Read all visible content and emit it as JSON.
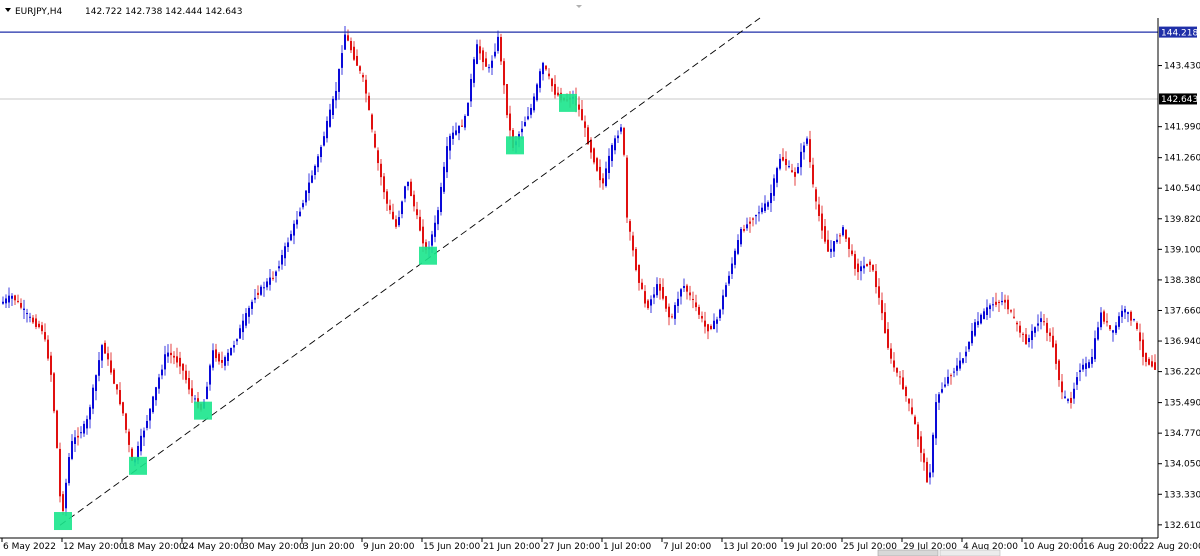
{
  "header": {
    "symbol": "EURJPY,H4",
    "ohlc": "142.722 142.738 142.444 142.643"
  },
  "colors": {
    "bull": "#0a0ad8",
    "bear": "#e01010",
    "resistance": "#1f2fa8",
    "current_price_line": "#c8c8c8",
    "trendline": "#000000",
    "marker": "#19e68c",
    "axis": "#000000"
  },
  "price_tags": {
    "resistance": "144.218",
    "current": "142.643"
  },
  "chart_data": {
    "type": "candlestick",
    "title": "",
    "xlabel": "",
    "ylabel": "",
    "ylim": [
      132.3,
      144.55
    ],
    "grid": false,
    "y_ticks": [
      "143.430",
      "142.643",
      "141.990",
      "141.260",
      "140.540",
      "139.820",
      "139.100",
      "138.380",
      "137.660",
      "136.940",
      "136.220",
      "135.490",
      "134.770",
      "134.050",
      "133.330",
      "132.610"
    ],
    "x_ticks": [
      "6 May 2022",
      "12 May 20:00",
      "18 May 20:00",
      "24 May 20:00",
      "30 May 20:00",
      "3 Jun 20:00",
      "9 Jun 20:00",
      "15 Jun 20:00",
      "21 Jun 20:00",
      "27 Jun 20:00",
      "1 Jul 20:00",
      "7 Jul 20:00",
      "13 Jul 20:00",
      "19 Jul 20:00",
      "25 Jul 20:00",
      "29 Jul 20:00",
      "4 Aug 20:00",
      "10 Aug 20:00",
      "16 Aug 20:00",
      "22 Aug 20:00"
    ],
    "resistance_level": 144.218,
    "current_price": 142.643,
    "price_path": [
      [
        0,
        137.8
      ],
      [
        14,
        138.0
      ],
      [
        30,
        137.5
      ],
      [
        44,
        137.2
      ],
      [
        52,
        136.3
      ],
      [
        58,
        134.6
      ],
      [
        63,
        132.7
      ],
      [
        72,
        134.5
      ],
      [
        88,
        135.0
      ],
      [
        104,
        136.9
      ],
      [
        114,
        136.1
      ],
      [
        124,
        135.3
      ],
      [
        134,
        134.0
      ],
      [
        150,
        135.2
      ],
      [
        168,
        136.7
      ],
      [
        182,
        136.4
      ],
      [
        194,
        135.6
      ],
      [
        204,
        135.3
      ],
      [
        214,
        136.7
      ],
      [
        224,
        136.4
      ],
      [
        236,
        136.9
      ],
      [
        256,
        138.0
      ],
      [
        276,
        138.5
      ],
      [
        298,
        139.8
      ],
      [
        320,
        141.3
      ],
      [
        338,
        142.9
      ],
      [
        346,
        144.2
      ],
      [
        356,
        143.6
      ],
      [
        366,
        143.0
      ],
      [
        376,
        141.5
      ],
      [
        388,
        140.2
      ],
      [
        398,
        139.6
      ],
      [
        408,
        140.8
      ],
      [
        420,
        139.7
      ],
      [
        428,
        139.0
      ],
      [
        438,
        139.8
      ],
      [
        450,
        141.7
      ],
      [
        466,
        142.1
      ],
      [
        478,
        143.9
      ],
      [
        490,
        143.3
      ],
      [
        500,
        144.1
      ],
      [
        508,
        142.4
      ],
      [
        514,
        141.5
      ],
      [
        524,
        142.0
      ],
      [
        534,
        142.5
      ],
      [
        544,
        143.5
      ],
      [
        556,
        142.8
      ],
      [
        566,
        142.6
      ],
      [
        574,
        142.7
      ],
      [
        582,
        142.3
      ],
      [
        590,
        141.6
      ],
      [
        604,
        140.6
      ],
      [
        612,
        141.4
      ],
      [
        624,
        142.1
      ],
      [
        628,
        139.9
      ],
      [
        638,
        138.6
      ],
      [
        648,
        137.7
      ],
      [
        660,
        138.3
      ],
      [
        672,
        137.4
      ],
      [
        684,
        138.3
      ],
      [
        696,
        137.8
      ],
      [
        708,
        137.2
      ],
      [
        718,
        137.4
      ],
      [
        728,
        138.3
      ],
      [
        742,
        139.5
      ],
      [
        756,
        139.9
      ],
      [
        770,
        140.2
      ],
      [
        782,
        141.3
      ],
      [
        796,
        140.8
      ],
      [
        808,
        141.8
      ],
      [
        816,
        140.3
      ],
      [
        830,
        139.0
      ],
      [
        844,
        139.6
      ],
      [
        858,
        138.6
      ],
      [
        872,
        138.8
      ],
      [
        880,
        138.0
      ],
      [
        892,
        136.5
      ],
      [
        904,
        135.9
      ],
      [
        916,
        135.0
      ],
      [
        924,
        134.2
      ],
      [
        930,
        133.5
      ],
      [
        938,
        135.6
      ],
      [
        950,
        136.1
      ],
      [
        964,
        136.5
      ],
      [
        976,
        137.3
      ],
      [
        992,
        137.8
      ],
      [
        1006,
        137.9
      ],
      [
        1018,
        137.3
      ],
      [
        1028,
        136.9
      ],
      [
        1042,
        137.5
      ],
      [
        1054,
        136.9
      ],
      [
        1064,
        135.6
      ],
      [
        1072,
        135.5
      ],
      [
        1080,
        136.3
      ],
      [
        1092,
        136.4
      ],
      [
        1102,
        137.6
      ],
      [
        1114,
        137.1
      ],
      [
        1124,
        137.7
      ],
      [
        1136,
        137.4
      ],
      [
        1146,
        136.5
      ],
      [
        1158,
        136.3
      ]
    ],
    "trendline": {
      "from": [
        60,
        132.6
      ],
      "to": [
        760,
        144.55
      ],
      "style": "dashed"
    },
    "markers": [
      [
        63,
        132.7
      ],
      [
        138,
        134.0
      ],
      [
        203,
        135.3
      ],
      [
        428,
        138.95
      ],
      [
        515,
        141.55
      ],
      [
        568,
        142.55
      ]
    ]
  }
}
